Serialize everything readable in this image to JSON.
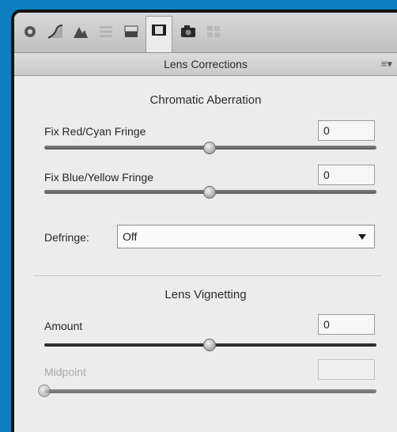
{
  "toolbar": {
    "tools": [
      "basic-icon",
      "tone-curve-icon",
      "detail-icon",
      "hsl-icon",
      "split-toning-icon",
      "lens-corrections-icon",
      "camera-calibration-icon",
      "presets-icon"
    ],
    "active_tool": "lens-corrections-icon"
  },
  "header": {
    "title": "Lens Corrections",
    "menu_glyph": "≡▾"
  },
  "chromatic": {
    "title": "Chromatic Aberration",
    "red_cyan": {
      "label": "Fix Red/Cyan Fringe",
      "value": "0",
      "level": 0.5
    },
    "blue_yellow": {
      "label": "Fix Blue/Yellow Fringe",
      "value": "0",
      "level": 0.5
    },
    "defringe": {
      "label": "Defringe:",
      "value": "Off"
    }
  },
  "vignetting": {
    "title": "Lens Vignetting",
    "amount": {
      "label": "Amount",
      "value": "0",
      "level": 0.5
    },
    "midpoint": {
      "label": "Midpoint",
      "value": "",
      "level": 0,
      "disabled": true
    }
  },
  "colors": {
    "background": "#0d7fc0",
    "panel": "#ececec"
  }
}
